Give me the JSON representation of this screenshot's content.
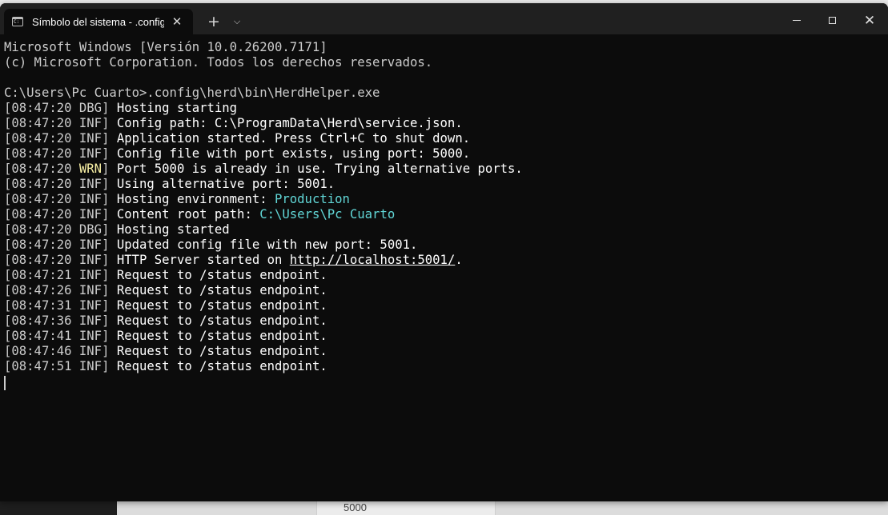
{
  "window": {
    "tab_title": "Símbolo del sistema - .config\\",
    "tab_close": "✕",
    "new_tab": "+",
    "dropdown": "⌵",
    "minimize": "",
    "maximize": "",
    "close": "✕"
  },
  "console": {
    "header": [
      "Microsoft Windows [Versión 10.0.26200.7171]",
      "(c) Microsoft Corporation. Todos los derechos reservados."
    ],
    "prompt": "C:\\Users\\Pc Cuarto>",
    "command": ".config\\herd\\bin\\HerdHelper.exe",
    "logs": [
      {
        "time": "08:47:20",
        "level": "DBG",
        "message": "Hosting starting",
        "highlight": ""
      },
      {
        "time": "08:47:20",
        "level": "INF",
        "message": "Config path: C:\\ProgramData\\Herd\\service.json.",
        "highlight": ""
      },
      {
        "time": "08:47:20",
        "level": "INF",
        "message": "Application started. Press Ctrl+C to shut down.",
        "highlight": ""
      },
      {
        "time": "08:47:20",
        "level": "INF",
        "message": "Config file with port exists, using port: 5000.",
        "highlight": ""
      },
      {
        "time": "08:47:20",
        "level": "WRN",
        "message": "Port 5000 is already in use. Trying alternative ports.",
        "highlight": ""
      },
      {
        "time": "08:47:20",
        "level": "INF",
        "message": "Using alternative port: 5001.",
        "highlight": ""
      },
      {
        "time": "08:47:20",
        "level": "INF",
        "message": "Hosting environment: ",
        "highlight": "Production"
      },
      {
        "time": "08:47:20",
        "level": "INF",
        "message": "Content root path: ",
        "highlight": "C:\\Users\\Pc Cuarto"
      },
      {
        "time": "08:47:20",
        "level": "DBG",
        "message": "Hosting started",
        "highlight": ""
      },
      {
        "time": "08:47:20",
        "level": "INF",
        "message": "Updated config file with new port: 5001.",
        "highlight": ""
      },
      {
        "time": "08:47:20",
        "level": "INF",
        "message": "HTTP Server started on ",
        "link": "http://localhost:5001/",
        "suffix": "."
      },
      {
        "time": "08:47:21",
        "level": "INF",
        "message": "Request to /status endpoint.",
        "highlight": ""
      },
      {
        "time": "08:47:26",
        "level": "INF",
        "message": "Request to /status endpoint.",
        "highlight": ""
      },
      {
        "time": "08:47:31",
        "level": "INF",
        "message": "Request to /status endpoint.",
        "highlight": ""
      },
      {
        "time": "08:47:36",
        "level": "INF",
        "message": "Request to /status endpoint.",
        "highlight": ""
      },
      {
        "time": "08:47:41",
        "level": "INF",
        "message": "Request to /status endpoint.",
        "highlight": ""
      },
      {
        "time": "08:47:46",
        "level": "INF",
        "message": "Request to /status endpoint.",
        "highlight": ""
      },
      {
        "time": "08:47:51",
        "level": "INF",
        "message": "Request to /status endpoint.",
        "highlight": ""
      }
    ]
  },
  "background": {
    "bottom_value": "5000"
  },
  "colors": {
    "console_bg": "#0c0c0c",
    "titlebar_bg": "#202020",
    "text_gray": "#cccccc",
    "text_white": "#ffffff",
    "warn": "#f9f1a5",
    "cyan": "#61d6d6"
  }
}
